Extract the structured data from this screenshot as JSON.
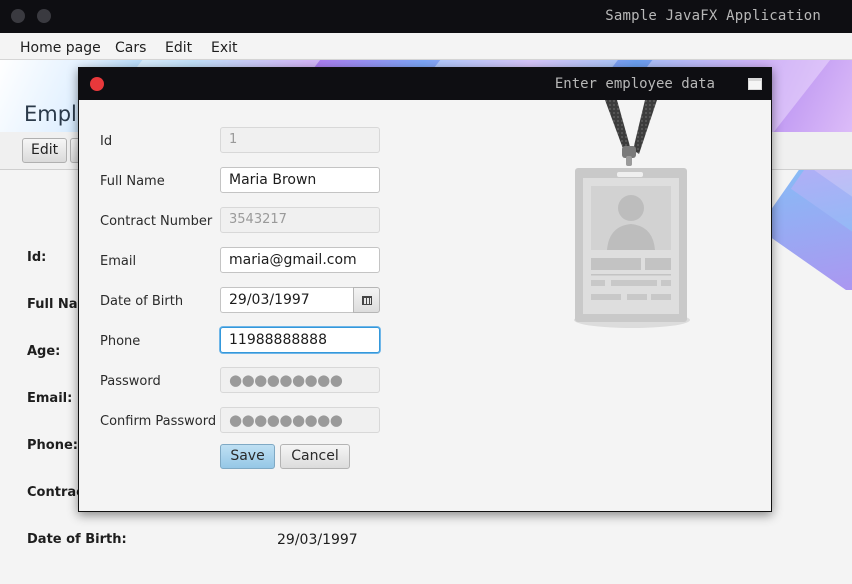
{
  "main_window": {
    "title": "Sample JavaFX Application",
    "menu": [
      "Home page",
      "Cars",
      "Edit",
      "Exit"
    ],
    "heading": "Emplo",
    "toolbar": {
      "edit_label": "Edit"
    },
    "details": {
      "labels": [
        "Id:",
        "Full Nar",
        "Age:",
        "Email:",
        "Phone:",
        "Contrac",
        "Date of Birth:"
      ],
      "date_of_birth_value": "29/03/1997"
    }
  },
  "dialog": {
    "title": "Enter employee data",
    "fields": {
      "id": {
        "label": "Id",
        "value": "1"
      },
      "full_name": {
        "label": "Full Name",
        "value": "Maria Brown"
      },
      "contract_number": {
        "label": "Contract Number",
        "value": "3543217"
      },
      "email": {
        "label": "Email",
        "value": "maria@gmail.com"
      },
      "date_of_birth": {
        "label": "Date of Birth",
        "value": "29/03/1997"
      },
      "phone": {
        "label": "Phone",
        "value": "11988888888"
      },
      "password": {
        "label": "Password",
        "value": "●●●●●●●●●"
      },
      "confirm_password": {
        "label": "Confirm Password",
        "value": "●●●●●●●●●"
      }
    },
    "buttons": {
      "save": "Save",
      "cancel": "Cancel"
    },
    "illustration": "id-badge-icon"
  },
  "colors": {
    "accent": "#3498db",
    "close": "#e8383b",
    "titlebar": "#0e0e12"
  }
}
